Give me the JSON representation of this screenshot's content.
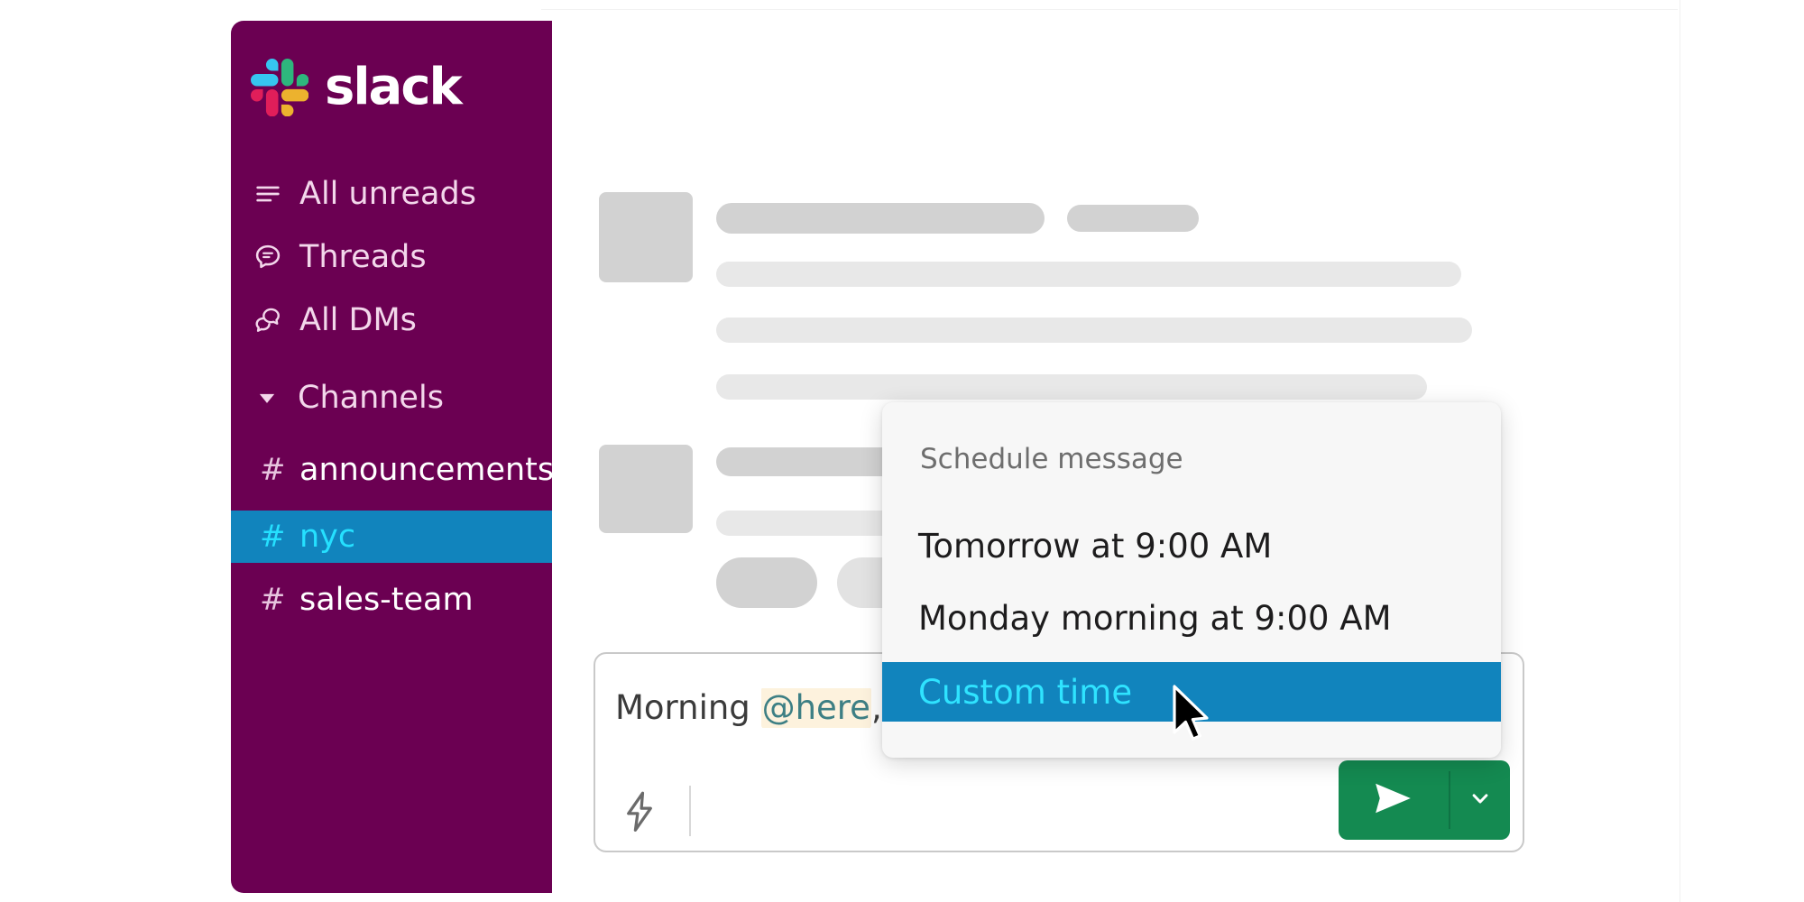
{
  "app": {
    "brand_name": "slack",
    "brand_icon": "slack-logo-icon"
  },
  "sidebar": {
    "accent_color": "#6b0052",
    "selected_color": "#1184bd",
    "selected_text_color": "#25e0ff",
    "label_color": "#f3d7eb",
    "nav": [
      {
        "label": "All unreads",
        "icon": "unreads-lines-icon"
      },
      {
        "label": "Threads",
        "icon": "thread-bubble-icon"
      },
      {
        "label": "All DMs",
        "icon": "direct-messages-bubbles-icon"
      }
    ],
    "channels_section": {
      "label": "Channels",
      "caret_icon": "chevron-down-filled-icon",
      "expanded": true,
      "items": [
        {
          "hash": "#",
          "name": "announcements",
          "selected": false
        },
        {
          "hash": "#",
          "name": "nyc",
          "selected": true
        },
        {
          "hash": "#",
          "name": "sales-team",
          "selected": false
        }
      ]
    }
  },
  "messages": {
    "placeholder_dark_color": "#d2d2d2",
    "placeholder_light_color": "#e8e8e8",
    "blocks": [
      {
        "avatar": "avatar-placeholder",
        "lines": 3,
        "has_meta": true
      },
      {
        "avatar": "avatar-placeholder",
        "lines": 1,
        "reactions": 2
      }
    ]
  },
  "composer": {
    "text_prefix": "Morning ",
    "mention": "@here",
    "text_suffix": ", c",
    "mention_highlight_color": "#fdf2dd",
    "shortcut_icon": "lightning-bolt-icon",
    "send_icon": "paper-plane-icon",
    "send_options_icon": "chevron-down-icon",
    "send_button_color": "#148a51"
  },
  "schedule_menu": {
    "title": "Schedule message",
    "highlight_color": "#1184bd",
    "highlight_text_color": "#2fe3ff",
    "options": [
      {
        "label": "Tomorrow at 9:00 AM",
        "highlighted": false
      },
      {
        "label": "Monday morning at 9:00 AM",
        "highlighted": false
      },
      {
        "label": "Custom time",
        "highlighted": true
      }
    ]
  },
  "cursor": {
    "icon": "mouse-pointer-arrow-icon"
  }
}
